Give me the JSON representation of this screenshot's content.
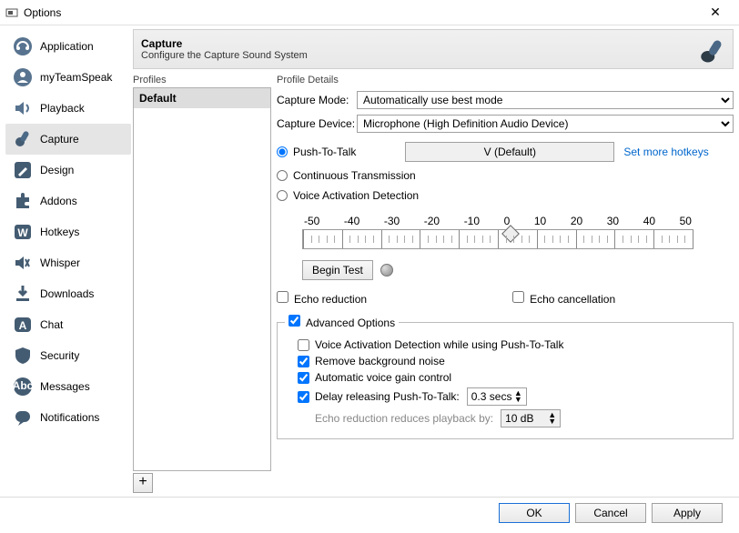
{
  "window": {
    "title": "Options"
  },
  "sidebar": {
    "items": [
      {
        "label": "Application"
      },
      {
        "label": "myTeamSpeak"
      },
      {
        "label": "Playback"
      },
      {
        "label": "Capture",
        "selected": true
      },
      {
        "label": "Design"
      },
      {
        "label": "Addons"
      },
      {
        "label": "Hotkeys"
      },
      {
        "label": "Whisper"
      },
      {
        "label": "Downloads"
      },
      {
        "label": "Chat"
      },
      {
        "label": "Security"
      },
      {
        "label": "Messages"
      },
      {
        "label": "Notifications"
      }
    ]
  },
  "header": {
    "title": "Capture",
    "subtitle": "Configure the Capture Sound System"
  },
  "profiles": {
    "section_label": "Profiles",
    "items": [
      "Default"
    ],
    "add_label": "+"
  },
  "details": {
    "section_label": "Profile Details",
    "mode_label": "Capture Mode:",
    "mode_value": "Automatically use best mode",
    "device_label": "Capture Device:",
    "device_value": "Microphone (High Definition Audio Device)",
    "ptt": {
      "ptt_label": "Push-To-Talk",
      "hotkey": "V (Default)",
      "set_more": "Set more hotkeys",
      "cont_label": "Continuous Transmission",
      "vad_label": "Voice Activation Detection"
    },
    "slider": {
      "ticks": [
        "-50",
        "-40",
        "-30",
        "-20",
        "-10",
        "0",
        "10",
        "20",
        "30",
        "40",
        "50"
      ]
    },
    "begin_test": "Begin Test",
    "checks": {
      "echo_reduction": "Echo reduction",
      "echo_cancel": "Echo cancellation"
    },
    "advanced": {
      "legend": "Advanced Options",
      "vad_ptt": "Voice Activation Detection while using Push-To-Talk",
      "rbg": "Remove background noise",
      "agc": "Automatic voice gain control",
      "delay_label": "Delay releasing Push-To-Talk:",
      "delay_value": "0.3 secs",
      "echo_note": "Echo reduction reduces playback by:",
      "echo_db": "10 dB"
    }
  },
  "footer": {
    "ok": "OK",
    "cancel": "Cancel",
    "apply": "Apply"
  }
}
